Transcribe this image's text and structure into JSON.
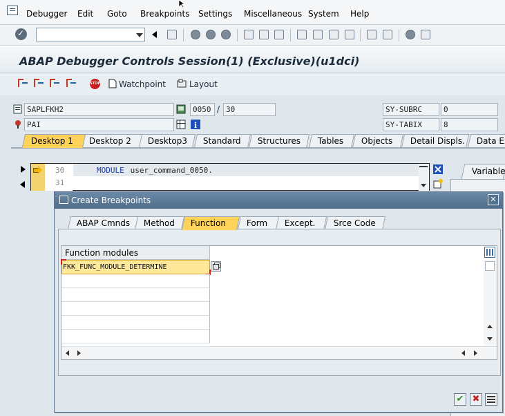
{
  "menu": [
    "Debugger",
    "Edit",
    "Goto",
    "Breakpoints",
    "Settings",
    "Miscellaneous",
    "System",
    "Help"
  ],
  "toolbar": {
    "command_field_value": ""
  },
  "title": "ABAP Debugger Controls Session(1)  (Exclusive)(u1dci)",
  "app_toolbar": {
    "watchpoint_label": "Watchpoint",
    "layout_label": "Layout"
  },
  "fields": {
    "program": "SAPLFKH2",
    "event": "PAI",
    "dynpro": "0050",
    "slash": "/",
    "dynpro_line": "30",
    "sy_subrc_label": "SY-SUBRC",
    "sy_subrc_value": "0",
    "sy_tabix_label": "SY-TABIX",
    "sy_tabix_value": "8"
  },
  "desktop_tabs": [
    "Desktop 1",
    "Desktop 2",
    "Desktop3",
    "Standard",
    "Structures",
    "Tables",
    "Objects",
    "Detail Displs.",
    "Data Ex"
  ],
  "code": {
    "lines": [
      {
        "no": "30",
        "keyword": "MODULE",
        "text": " user_command_0050."
      },
      {
        "no": "31",
        "keyword": "",
        "text": ""
      }
    ]
  },
  "right_pane": {
    "tab_label": "Variables"
  },
  "dialog": {
    "title": "Create Breakpoints",
    "tabs": [
      "ABAP Cmnds",
      "Method",
      "Function",
      "Form",
      "Except.",
      "Srce Code"
    ],
    "active_tab": "Function",
    "grid": {
      "column_header": "Function modules",
      "rows": [
        "FKK_FUNC_MODULE_DETERMINE",
        "",
        "",
        "",
        "",
        ""
      ]
    }
  },
  "colors": {
    "active_tab": "#ffd35a",
    "dialog_title": "#4d6c89",
    "accent_blue": "#1e3fa8",
    "confirm_green": "#2f8f2f",
    "cancel_red": "#c02020"
  }
}
